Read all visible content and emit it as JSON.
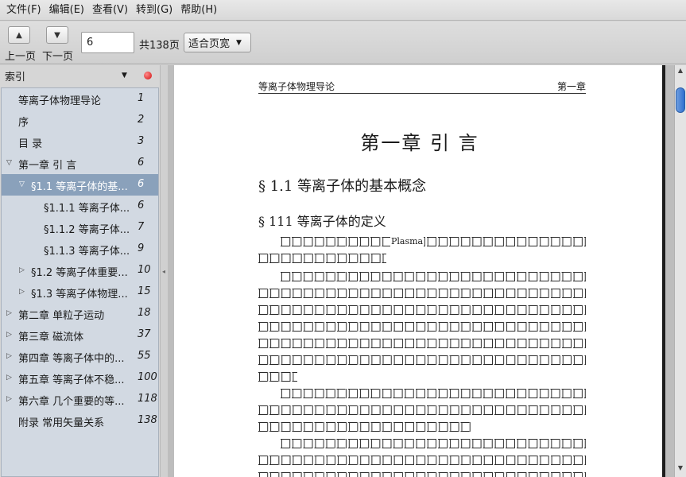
{
  "menu": [
    "文件(F)",
    "编辑(E)",
    "查看(V)",
    "转到(G)",
    "帮助(H)"
  ],
  "toolbar": {
    "prev_label": "上一页",
    "next_label": "下一页",
    "page_value": "6",
    "page_total": "共138页",
    "zoom": "适合页宽"
  },
  "sidebar": {
    "panel_title": "索引",
    "toc": [
      {
        "title": "等离子体物理导论",
        "page": "1",
        "level": 0,
        "expander": "none"
      },
      {
        "title": "序",
        "page": "2",
        "level": 0,
        "expander": "none"
      },
      {
        "title": "目 录",
        "page": "3",
        "level": 0,
        "expander": "none"
      },
      {
        "title": "第一章 引 言",
        "page": "6",
        "level": 0,
        "expander": "expanded"
      },
      {
        "title": "§1.1 等离子体的基...",
        "page": "6",
        "level": 1,
        "expander": "expanded",
        "selected": true
      },
      {
        "title": "§1.1.1 等离子体...",
        "page": "6",
        "level": 2,
        "expander": "none"
      },
      {
        "title": "§1.1.2 等离子体...",
        "page": "7",
        "level": 2,
        "expander": "none"
      },
      {
        "title": "§1.1.3 等离子体...",
        "page": "9",
        "level": 2,
        "expander": "none"
      },
      {
        "title": "§1.2 等离子体重要...",
        "page": "10",
        "level": 1,
        "expander": "collapsed"
      },
      {
        "title": "§1.3 等离子体物理...",
        "page": "15",
        "level": 1,
        "expander": "collapsed"
      },
      {
        "title": "第二章 单粒子运动",
        "page": "18",
        "level": 0,
        "expander": "collapsed"
      },
      {
        "title": "第三章 磁流体",
        "page": "37",
        "level": 0,
        "expander": "collapsed"
      },
      {
        "title": "第四章 等离子体中的...",
        "page": "55",
        "level": 0,
        "expander": "collapsed"
      },
      {
        "title": "第五章 等离子体不稳...",
        "page": "100",
        "level": 0,
        "expander": "collapsed"
      },
      {
        "title": "第六章 几个重要的等...",
        "page": "118",
        "level": 0,
        "expander": "collapsed"
      },
      {
        "title": "附录 常用矢量关系",
        "page": "138",
        "level": 0,
        "expander": "none"
      }
    ]
  },
  "document": {
    "running_head_left": "等离子体物理导论",
    "running_head_right": "第一章",
    "chapter_title": "第一章 引 言",
    "section_title": "§ 1.1 等离子体的基本概念",
    "subsection_title": "§ 111 等离子体的定义",
    "inline_word": "Plasma"
  },
  "icons": {
    "prev": "triangle-up-icon",
    "next": "triangle-down-icon",
    "panel_close": "red-close-dot-icon"
  }
}
